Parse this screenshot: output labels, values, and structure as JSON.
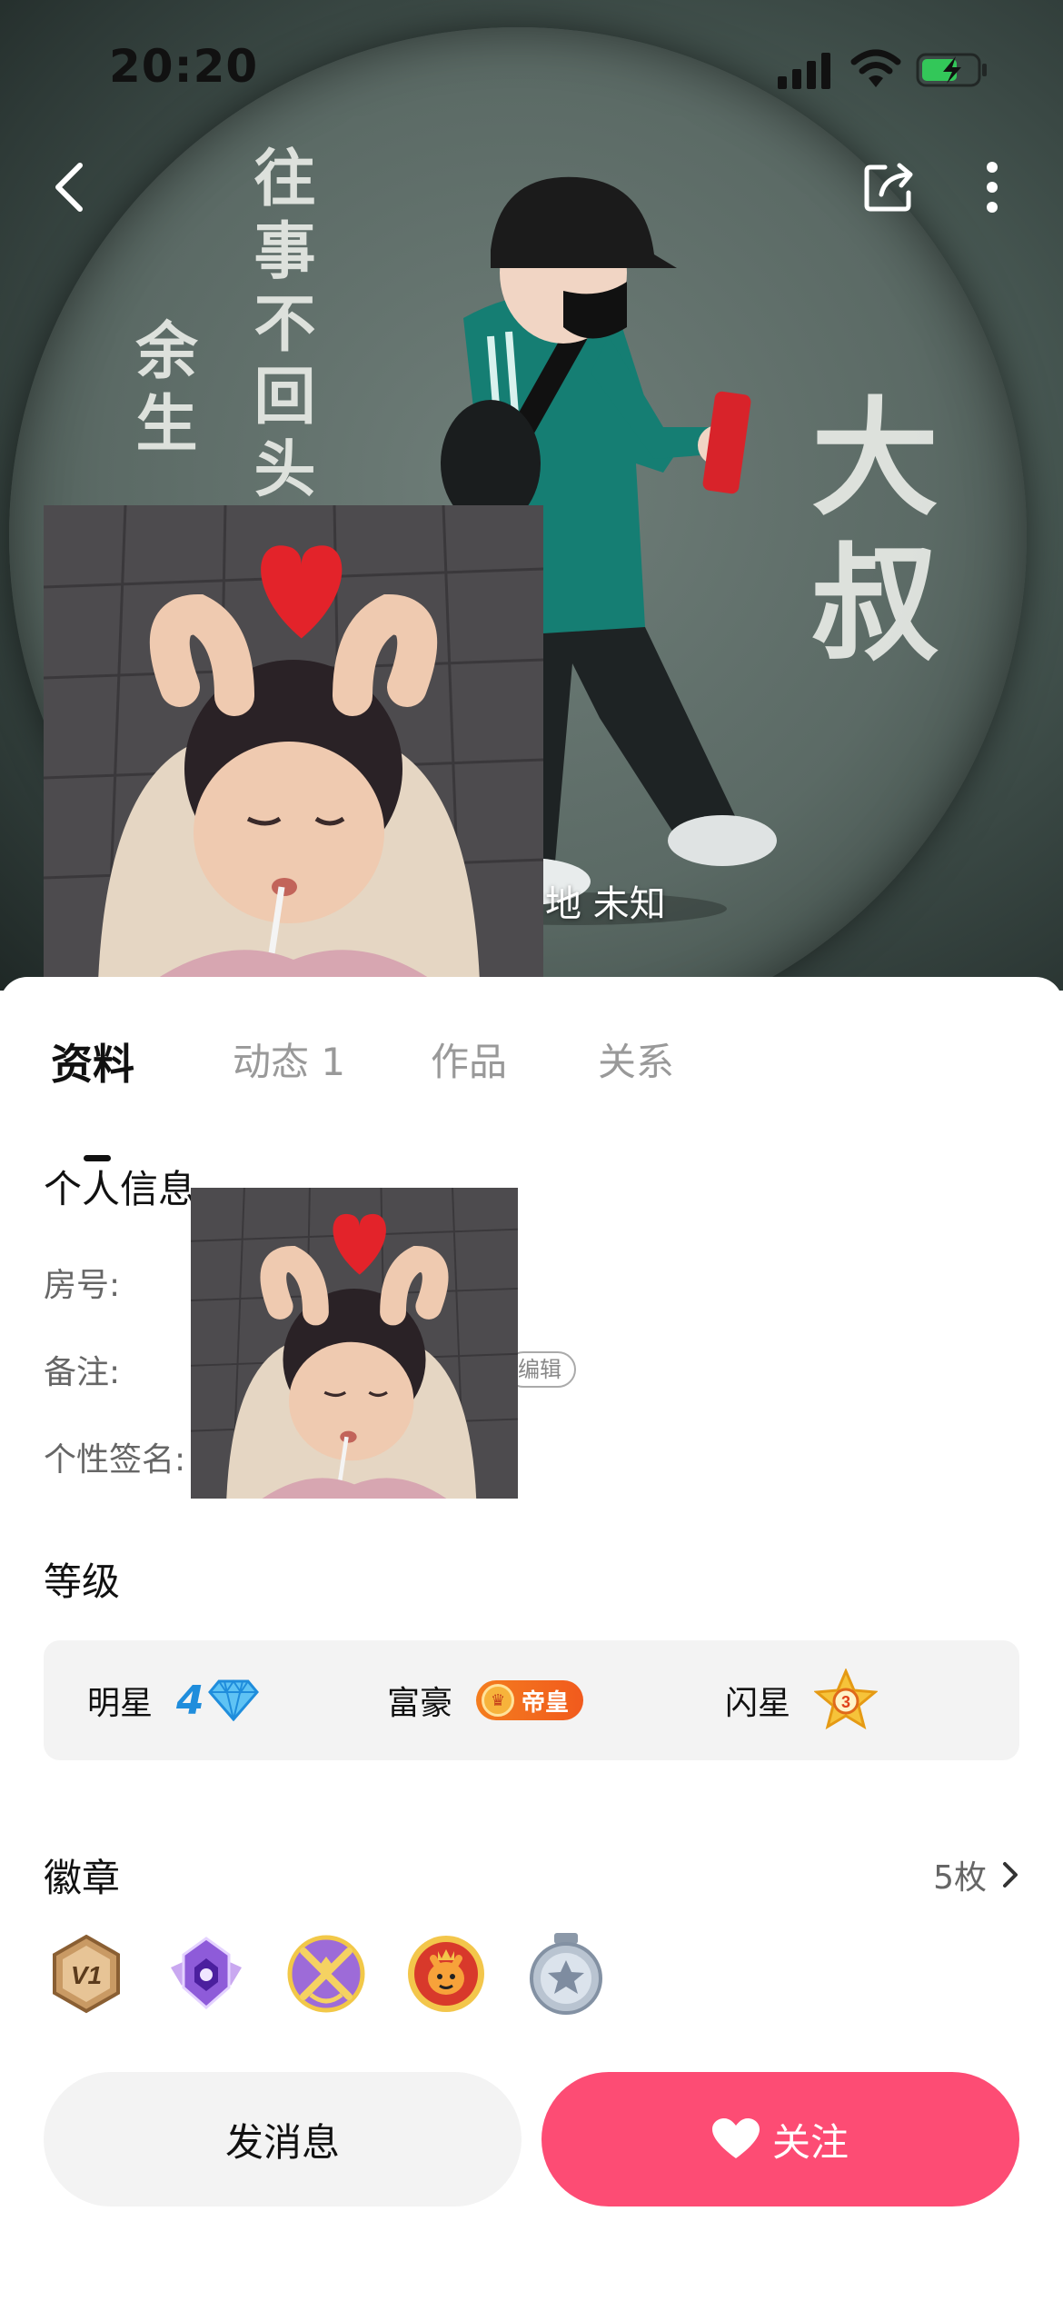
{
  "status": {
    "time": "20:20"
  },
  "cover": {
    "calligraphy_main": "往事不回头",
    "calligraphy_left": "余生",
    "calligraphy_right": "大叔",
    "location": "地 未知"
  },
  "tabs": [
    {
      "label": "资料",
      "active": true
    },
    {
      "label": "动态 1",
      "active": false
    },
    {
      "label": "作品",
      "active": false
    },
    {
      "label": "关系",
      "active": false
    }
  ],
  "personal_info": {
    "title": "个人信息",
    "room_label": "房号:",
    "note_label": "备注:",
    "edit_label": "编辑",
    "signature_label": "个性签名:"
  },
  "level": {
    "title": "等级",
    "star_label": "明星",
    "star_value": "4",
    "rich_label": "富豪",
    "rich_value": "帝皇",
    "flash_label": "闪星",
    "flash_value": "3"
  },
  "badges": {
    "title": "徽章",
    "count": "5枚",
    "items": [
      "v1-medal-icon",
      "purple-gem-medal-icon",
      "crossed-swords-medal-icon",
      "tiger-medal-icon",
      "silver-star-medal-icon"
    ]
  },
  "actions": {
    "message_label": "发消息",
    "follow_label": "关注"
  },
  "colors": {
    "accent_pink": "#fd4c74",
    "star_blue": "#1f8ddc",
    "rich_orange": "#f15a1d",
    "battery_green": "#33c759"
  }
}
